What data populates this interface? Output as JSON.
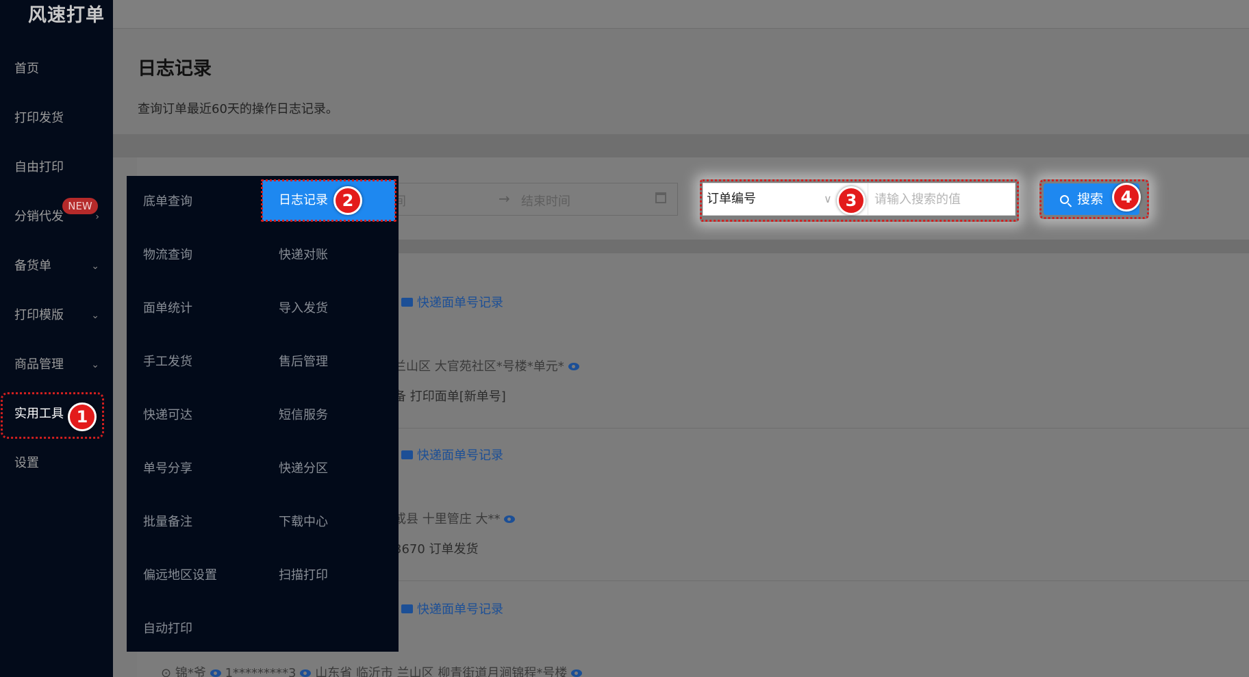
{
  "app": {
    "title": "风速打单"
  },
  "sidebar": {
    "items": [
      {
        "label": "首页"
      },
      {
        "label": "打印发货"
      },
      {
        "label": "自由打印"
      },
      {
        "label": "分销代发",
        "badge": "NEW"
      },
      {
        "label": "备货单"
      },
      {
        "label": "打印模版"
      },
      {
        "label": "商品管理"
      },
      {
        "label": "实用工具"
      },
      {
        "label": "设置"
      }
    ]
  },
  "page": {
    "title": "日志记录",
    "description": "查询订单最近60天的操作日志记录。"
  },
  "filters": {
    "start_placeholder": "间",
    "end_placeholder": "结束时间",
    "select_value": "订单编号",
    "search_placeholder": "请输入搜索的值",
    "search_button": "搜索"
  },
  "menu": {
    "items": [
      "底单查询",
      "日志记录",
      "物流查询",
      "快递对账",
      "面单统计",
      "导入发货",
      "手工发货",
      "售后管理",
      "快递可达",
      "短信服务",
      "单号分享",
      "快递分区",
      "批量备注",
      "下载中心",
      "偏远地区设置",
      "扫描打印",
      "自动打印"
    ],
    "selected": "日志记录"
  },
  "steps": [
    "1",
    "2",
    "3",
    "4"
  ],
  "log": {
    "link_label": "快递面单号记录",
    "row1_address": "兰山区 大官苑社区*号楼*单元*",
    "row1_action": "备 打印面单[新单号]",
    "row2_address": "或县 十里管庄 大**",
    "row2_action": "3670 订单发货",
    "row3_contact": "锦*爷",
    "row3_phone": "1*********3",
    "row3_address": "山东省 临沂市 兰山区 柳青街道月涧锦程*号楼"
  },
  "colors": {
    "accent": "#1e88f0",
    "sidebar": "#030b1a",
    "highlight": "#d01f1f"
  }
}
